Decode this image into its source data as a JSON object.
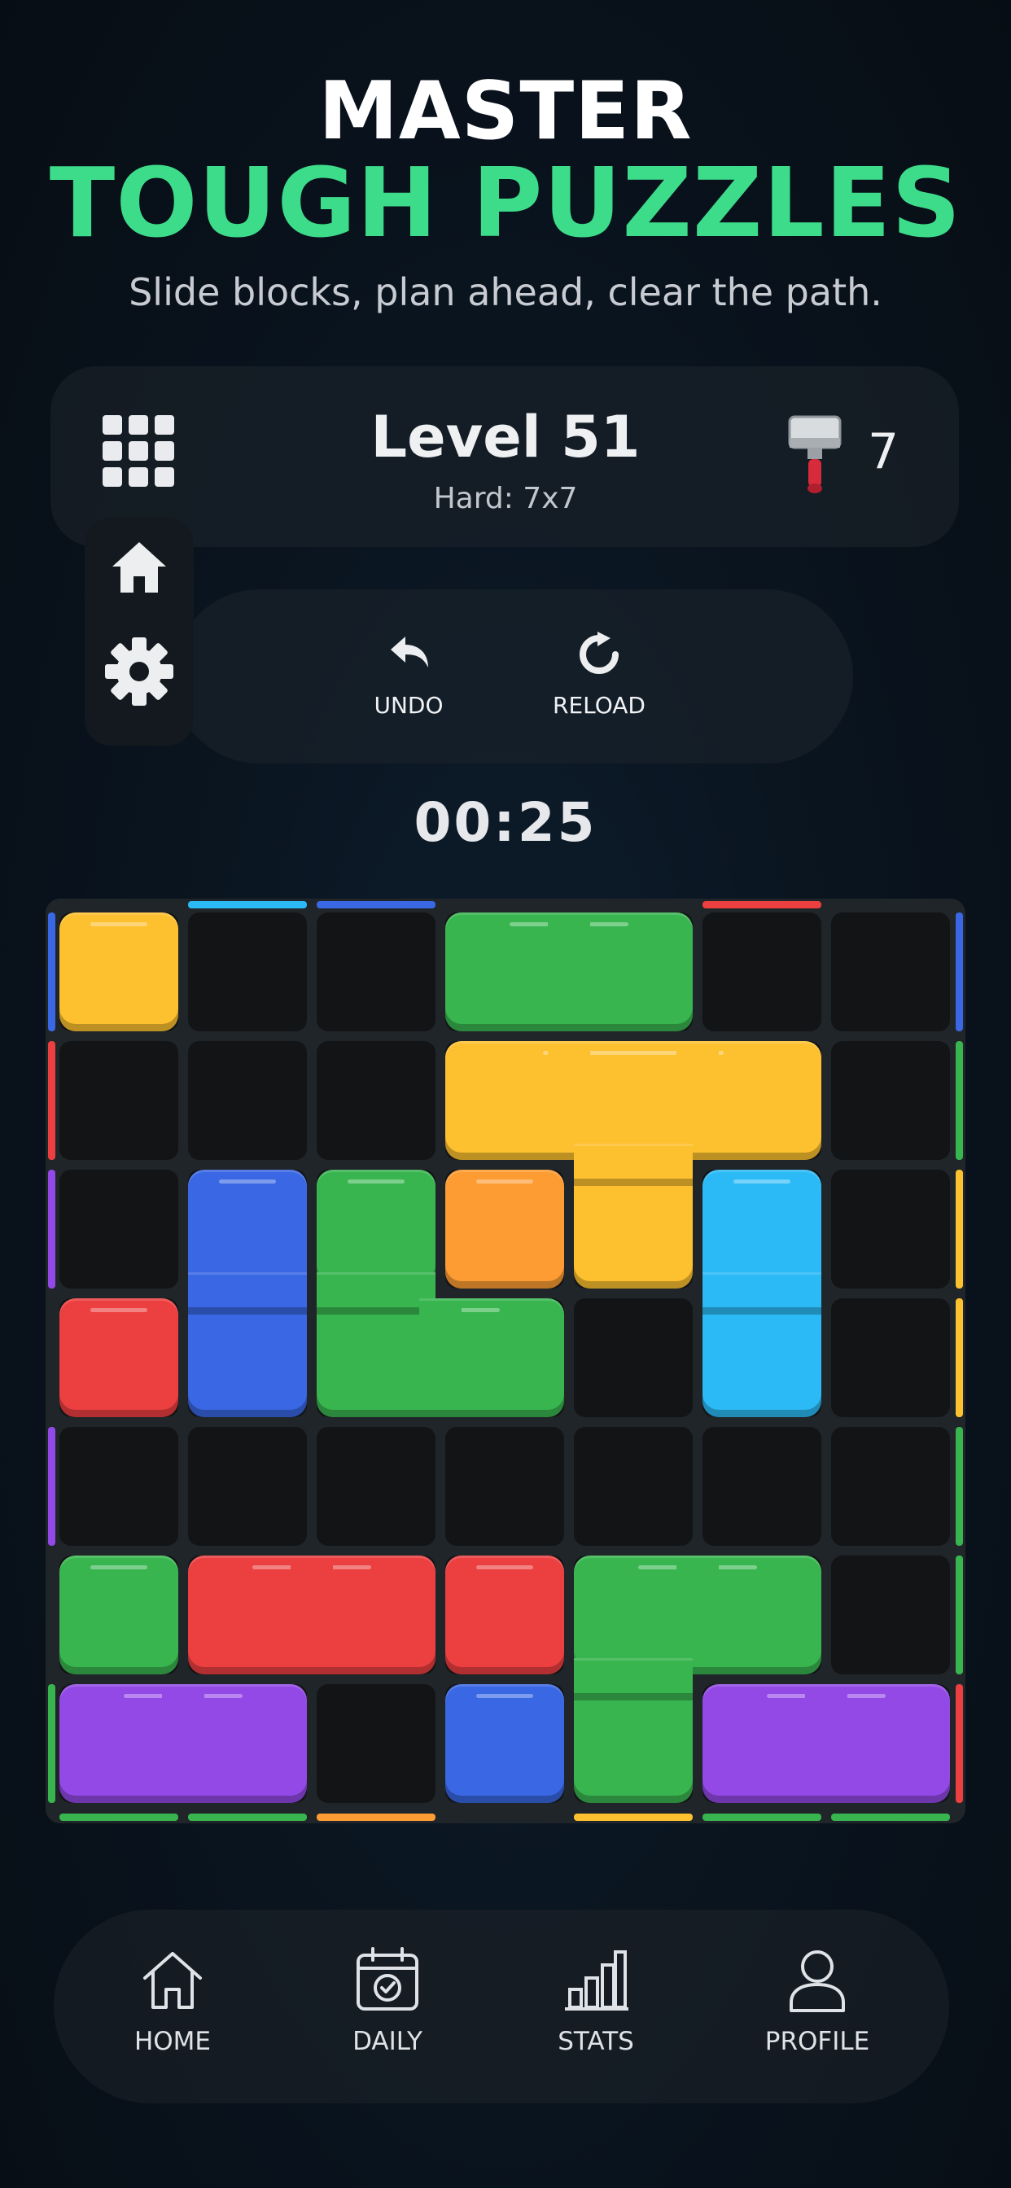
{
  "hero": {
    "line1": "MASTER",
    "line2": "TOUGH PUZZLES",
    "subtitle": "Slide blocks, plan ahead, clear the path."
  },
  "level": {
    "title": "Level 51",
    "difficulty": "Hard: 7x7",
    "hammer_count": "7"
  },
  "tools": {
    "undo": "UNDO",
    "reload": "RELOAD"
  },
  "timer": "00:25",
  "nav": {
    "home": "HOME",
    "daily": "DAILY",
    "stats": "STATS",
    "profile": "PROFILE"
  },
  "icons": [
    "grid-menu-icon",
    "hammer-icon",
    "home-icon",
    "gear-icon",
    "undo-icon",
    "reload-icon",
    "calendar-check-icon",
    "bar-chart-icon",
    "user-icon"
  ],
  "colors": {
    "yellow": "#fdc02f",
    "green": "#38b54f",
    "blue": "#3a67e3",
    "cyan": "#2bbaf5",
    "red": "#ec3f40",
    "orange": "#fd9c33",
    "purple": "#9249e5",
    "accent": "#3ddc8a"
  },
  "board": {
    "rows": 7,
    "cols": 7,
    "blocks": [
      {
        "color": "yellow",
        "cells": [
          [
            0,
            0
          ]
        ]
      },
      {
        "color": "green",
        "cells": [
          [
            0,
            3
          ],
          [
            0,
            4
          ]
        ]
      },
      {
        "color": "yellow",
        "cells": [
          [
            1,
            3
          ],
          [
            1,
            4
          ],
          [
            1,
            5
          ],
          [
            2,
            4
          ]
        ]
      },
      {
        "color": "red",
        "cells": [
          [
            3,
            0
          ]
        ]
      },
      {
        "color": "blue",
        "cells": [
          [
            2,
            1
          ],
          [
            3,
            1
          ]
        ]
      },
      {
        "color": "green",
        "cells": [
          [
            2,
            2
          ],
          [
            3,
            2
          ],
          [
            3,
            3
          ]
        ]
      },
      {
        "color": "orange",
        "cells": [
          [
            2,
            3
          ]
        ]
      },
      {
        "color": "cyan",
        "cells": [
          [
            2,
            5
          ],
          [
            3,
            5
          ]
        ]
      },
      {
        "color": "green",
        "cells": [
          [
            5,
            0
          ]
        ]
      },
      {
        "color": "red",
        "cells": [
          [
            5,
            1
          ],
          [
            5,
            2
          ]
        ]
      },
      {
        "color": "red",
        "cells": [
          [
            5,
            3
          ]
        ]
      },
      {
        "color": "green",
        "cells": [
          [
            5,
            4
          ],
          [
            5,
            5
          ],
          [
            6,
            4
          ]
        ]
      },
      {
        "color": "purple",
        "cells": [
          [
            6,
            0
          ],
          [
            6,
            1
          ]
        ]
      },
      {
        "color": "blue",
        "cells": [
          [
            6,
            3
          ]
        ]
      },
      {
        "color": "purple",
        "cells": [
          [
            6,
            5
          ],
          [
            6,
            6
          ]
        ]
      }
    ],
    "exits": {
      "top": [
        {
          "col": 1,
          "color": "cyan"
        },
        {
          "col": 2,
          "color": "blue"
        },
        {
          "col": 5,
          "color": "red"
        }
      ],
      "bottom": [
        {
          "col": 0,
          "color": "green"
        },
        {
          "col": 1,
          "color": "green"
        },
        {
          "col": 2,
          "color": "orange"
        },
        {
          "col": 4,
          "color": "yellow"
        },
        {
          "col": 5,
          "color": "green"
        },
        {
          "col": 6,
          "color": "green"
        }
      ],
      "left": [
        {
          "row": 0,
          "color": "blue"
        },
        {
          "row": 1,
          "color": "red"
        },
        {
          "row": 2,
          "color": "purple"
        },
        {
          "row": 4,
          "color": "purple"
        },
        {
          "row": 6,
          "color": "green"
        }
      ],
      "right": [
        {
          "row": 0,
          "color": "blue"
        },
        {
          "row": 1,
          "color": "green"
        },
        {
          "row": 2,
          "color": "yellow"
        },
        {
          "row": 3,
          "color": "yellow"
        },
        {
          "row": 4,
          "color": "green"
        },
        {
          "row": 5,
          "color": "green"
        },
        {
          "row": 6,
          "color": "red"
        }
      ]
    }
  }
}
